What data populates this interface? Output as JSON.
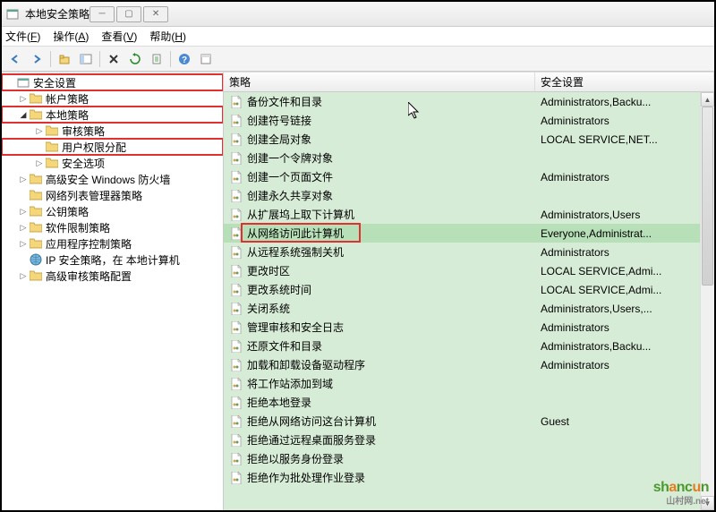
{
  "title": "本地安全策略",
  "menubar": [
    {
      "label": "文件",
      "hotkey": "F"
    },
    {
      "label": "操作",
      "hotkey": "A"
    },
    {
      "label": "查看",
      "hotkey": "V"
    },
    {
      "label": "帮助",
      "hotkey": "H"
    }
  ],
  "tree": [
    {
      "label": "安全设置",
      "depth": 0,
      "icon": "root",
      "arrow": "",
      "highlight": true
    },
    {
      "label": "帐户策略",
      "depth": 1,
      "icon": "folder",
      "arrow": "▷"
    },
    {
      "label": "本地策略",
      "depth": 1,
      "icon": "folder",
      "arrow": "▿",
      "highlight": true
    },
    {
      "label": "审核策略",
      "depth": 2,
      "icon": "folder",
      "arrow": "▷"
    },
    {
      "label": "用户权限分配",
      "depth": 2,
      "icon": "folder",
      "arrow": "",
      "highlight": true
    },
    {
      "label": "安全选项",
      "depth": 2,
      "icon": "folder",
      "arrow": "▷"
    },
    {
      "label": "高级安全 Windows 防火墙",
      "depth": 1,
      "icon": "folder",
      "arrow": "▷"
    },
    {
      "label": "网络列表管理器策略",
      "depth": 1,
      "icon": "folder",
      "arrow": ""
    },
    {
      "label": "公钥策略",
      "depth": 1,
      "icon": "folder",
      "arrow": "▷"
    },
    {
      "label": "软件限制策略",
      "depth": 1,
      "icon": "folder",
      "arrow": "▷"
    },
    {
      "label": "应用程序控制策略",
      "depth": 1,
      "icon": "folder",
      "arrow": "▷"
    },
    {
      "label": "IP 安全策略，在 本地计算机",
      "depth": 1,
      "icon": "globe",
      "arrow": ""
    },
    {
      "label": "高级审核策略配置",
      "depth": 1,
      "icon": "folder",
      "arrow": "▷"
    }
  ],
  "columns": {
    "policy": "策略",
    "setting": "安全设置"
  },
  "rows": [
    {
      "policy": "备份文件和目录",
      "setting": "Administrators,Backu..."
    },
    {
      "policy": "创建符号链接",
      "setting": "Administrators"
    },
    {
      "policy": "创建全局对象",
      "setting": "LOCAL SERVICE,NET..."
    },
    {
      "policy": "创建一个令牌对象",
      "setting": ""
    },
    {
      "policy": "创建一个页面文件",
      "setting": "Administrators"
    },
    {
      "policy": "创建永久共享对象",
      "setting": ""
    },
    {
      "policy": "从扩展坞上取下计算机",
      "setting": "Administrators,Users"
    },
    {
      "policy": "从网络访问此计算机",
      "setting": "Everyone,Administrat...",
      "selected": true,
      "highlight": true
    },
    {
      "policy": "从远程系统强制关机",
      "setting": "Administrators"
    },
    {
      "policy": "更改时区",
      "setting": "LOCAL SERVICE,Admi..."
    },
    {
      "policy": "更改系统时间",
      "setting": "LOCAL SERVICE,Admi..."
    },
    {
      "policy": "关闭系统",
      "setting": "Administrators,Users,..."
    },
    {
      "policy": "管理审核和安全日志",
      "setting": "Administrators"
    },
    {
      "policy": "还原文件和目录",
      "setting": "Administrators,Backu..."
    },
    {
      "policy": "加载和卸载设备驱动程序",
      "setting": "Administrators"
    },
    {
      "policy": "将工作站添加到域",
      "setting": ""
    },
    {
      "policy": "拒绝本地登录",
      "setting": ""
    },
    {
      "policy": "拒绝从网络访问这台计算机",
      "setting": "Guest"
    },
    {
      "policy": "拒绝通过远程桌面服务登录",
      "setting": ""
    },
    {
      "policy": "拒绝以服务身份登录",
      "setting": ""
    },
    {
      "policy": "拒绝作为批处理作业登录",
      "setting": ""
    }
  ],
  "watermark": {
    "text": "shancun",
    "suffix": ".net",
    "url_prefix": "山村网"
  }
}
